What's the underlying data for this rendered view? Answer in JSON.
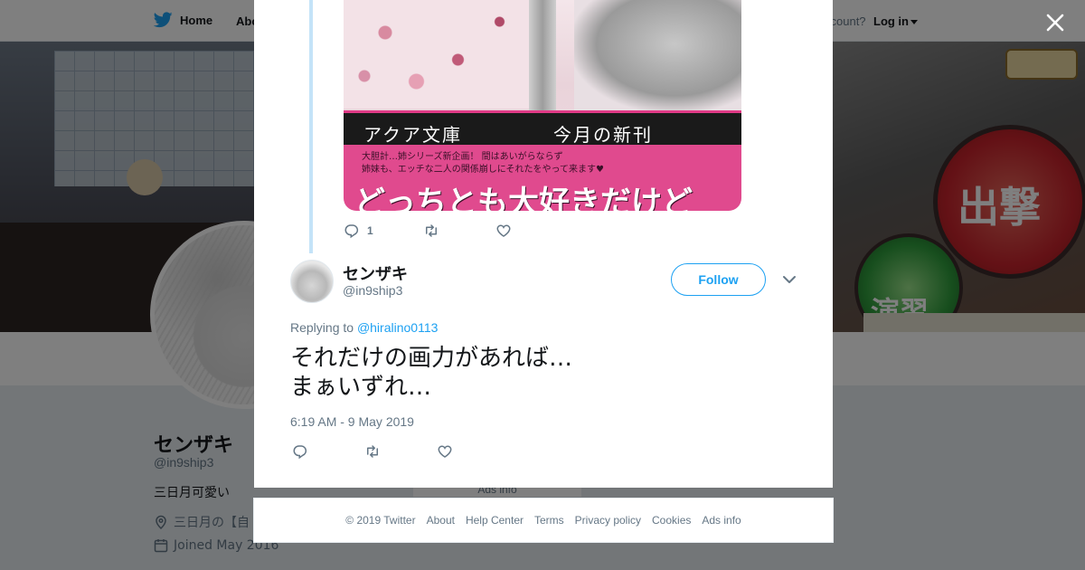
{
  "topnav": {
    "home_label": "Home",
    "about_label": "Abo",
    "account_text": "ccount?",
    "login_label": "Log in"
  },
  "banner": {
    "badge_sortie": "出撃",
    "badge_exercise": "演習"
  },
  "profile": {
    "name": "センザキ",
    "handle": "@in9ship3",
    "bio": "三日月可愛い",
    "location": "三日月の【自",
    "joined": "Joined May 2016",
    "ads_ghost": "Ads info"
  },
  "quoted_media": {
    "bar_left": "アクア文庫",
    "bar_right": "今月の新刊",
    "small_line1": "大胆計…姉シリーズ新企画！ 間はあいがらならず",
    "small_line2": "姉妹も、エッチな二人の関係崩しにそれたをやって来ます♥",
    "big_title": "どっちとも大好きだけど"
  },
  "parent_tweet_actions": {
    "reply_count": "1"
  },
  "tweet": {
    "name": "センザキ",
    "handle": "@in9ship3",
    "follow_label": "Follow",
    "replying_prefix": "Replying to ",
    "replying_to": "@hiralino0113",
    "text_line1": "それだけの画力があれば…",
    "text_line2": "まぁいずれ…",
    "timestamp": "6:19 AM - 9 May 2019"
  },
  "footer": {
    "copyright": "© 2019 Twitter",
    "links": [
      "About",
      "Help Center",
      "Terms",
      "Privacy policy",
      "Cookies",
      "Ads info"
    ]
  },
  "colors": {
    "accent": "#1da1f2",
    "text_primary": "#14171a",
    "text_secondary": "#657786",
    "thread_line": "#c4e3f8"
  },
  "icons": [
    "twitter-bird-icon",
    "caret-down-icon",
    "close-icon",
    "reply-icon",
    "retweet-icon",
    "like-icon",
    "location-icon",
    "calendar-icon",
    "chevron-down-icon"
  ]
}
